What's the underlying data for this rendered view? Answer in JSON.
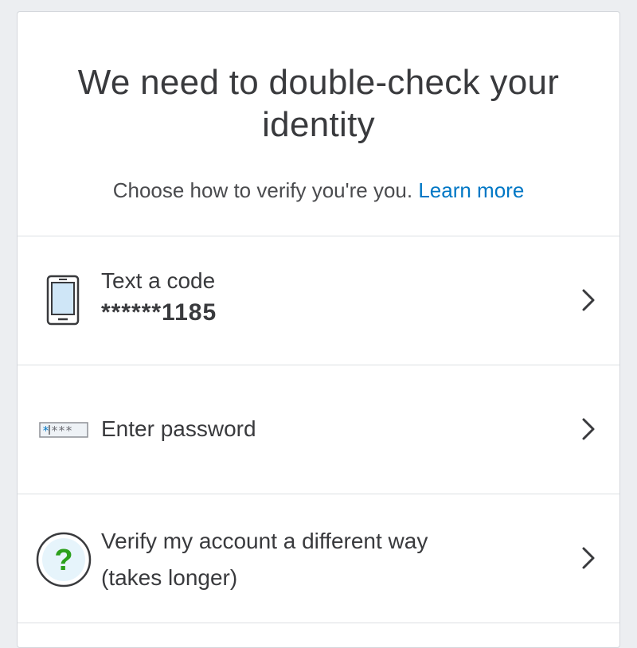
{
  "header": {
    "title": "We need to double-check your identity",
    "subtitle": "Choose how to verify you're you.",
    "learn_more": "Learn more"
  },
  "options": [
    {
      "label": "Text a code",
      "detail": "******1185",
      "icon": "phone-icon"
    },
    {
      "label": "Enter password",
      "icon": "password-field-icon"
    },
    {
      "label_line1": "Verify my account a different way",
      "label_line2": "(takes longer)",
      "icon": "question-mark-icon"
    }
  ],
  "colors": {
    "link": "#0077c5",
    "text": "#393a3d",
    "accent_green": "#2ca01c",
    "icon_fill": "#cfe6f7"
  }
}
